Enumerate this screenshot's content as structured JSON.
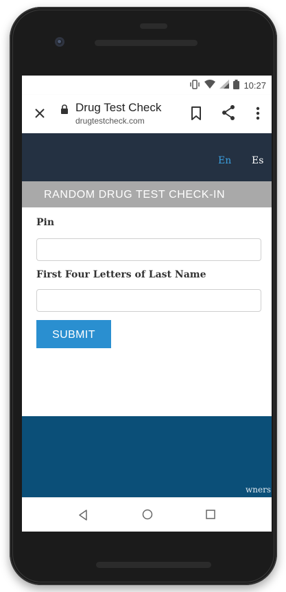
{
  "status_bar": {
    "time": "10:27",
    "icons": [
      "vibrate-icon",
      "wifi-icon",
      "signal-icon",
      "battery-icon"
    ]
  },
  "browser": {
    "page_title": "Drug Test Check",
    "url": "drugtestcheck.com",
    "icons": [
      "close-icon",
      "lock-icon",
      "bookmark-icon",
      "share-icon",
      "more-vertical-icon"
    ]
  },
  "site_header": {
    "lang_en": "En",
    "lang_es": "Es",
    "colors": {
      "background": "#243142",
      "active_lang": "#3ba0e0"
    }
  },
  "banner": {
    "title": "RANDOM DRUG TEST CHECK-IN",
    "color": "#a9a9a9"
  },
  "form": {
    "pin_label": "Pin",
    "pin_value": "",
    "last_name_label": "First Four Letters of Last Name",
    "last_name_value": "",
    "submit_label": "SUBMIT",
    "submit_color": "#2a8fd0"
  },
  "footer": {
    "color": "#0b4f78",
    "visible_text": "wners."
  },
  "nav_bar": {
    "icons": [
      "back-icon",
      "home-icon",
      "recents-icon"
    ]
  }
}
